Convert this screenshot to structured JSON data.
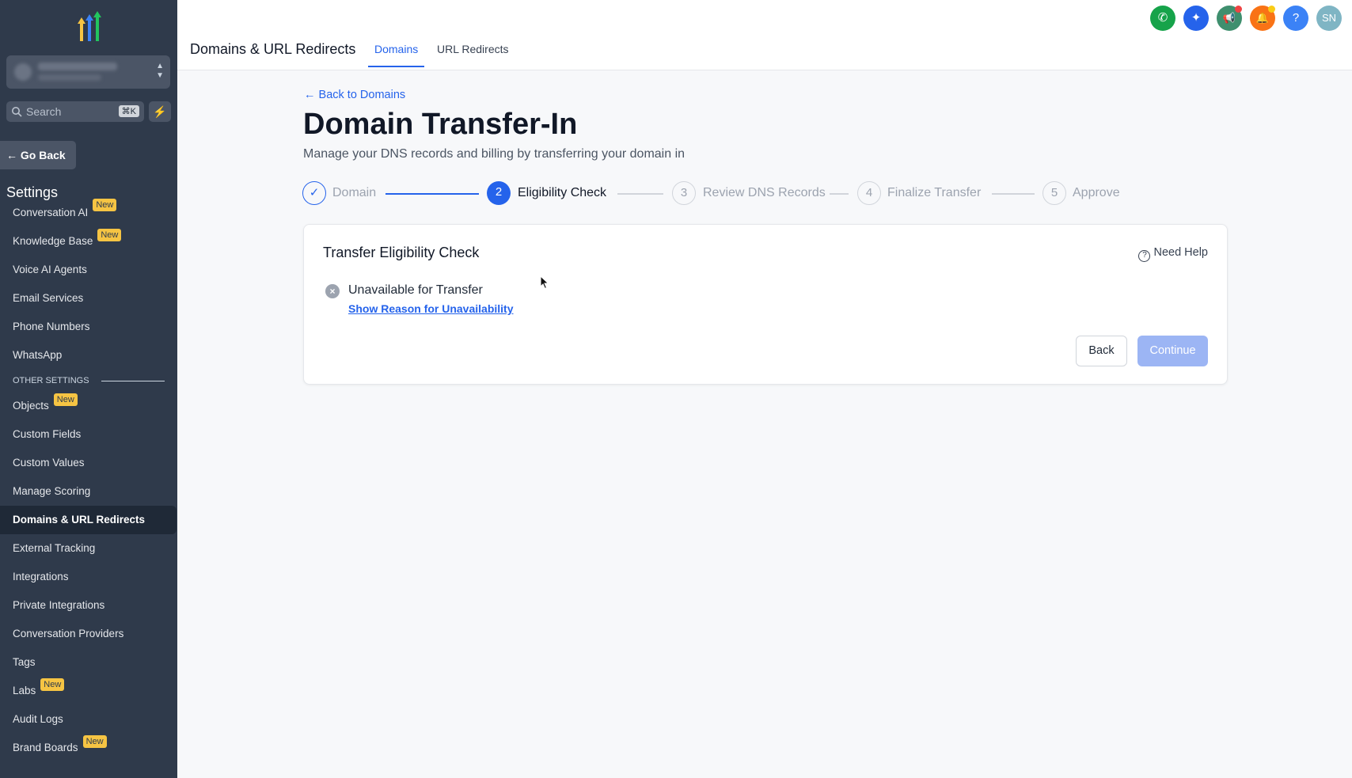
{
  "sidebar": {
    "search_placeholder": "Search",
    "search_shortcut": "⌘K",
    "go_back_label": "Go Back",
    "settings_title": "Settings",
    "items_top": [
      {
        "label": "Conversation AI",
        "badge": "New"
      },
      {
        "label": "Knowledge Base",
        "badge": "New"
      },
      {
        "label": "Voice AI Agents",
        "badge": ""
      },
      {
        "label": "Email Services",
        "badge": ""
      },
      {
        "label": "Phone Numbers",
        "badge": ""
      },
      {
        "label": "WhatsApp",
        "badge": ""
      }
    ],
    "section_label": "OTHER SETTINGS",
    "items_bottom": [
      {
        "label": "Objects",
        "badge": "New"
      },
      {
        "label": "Custom Fields",
        "badge": ""
      },
      {
        "label": "Custom Values",
        "badge": ""
      },
      {
        "label": "Manage Scoring",
        "badge": ""
      },
      {
        "label": "Domains & URL Redirects",
        "badge": "",
        "active": true
      },
      {
        "label": "External Tracking",
        "badge": ""
      },
      {
        "label": "Integrations",
        "badge": ""
      },
      {
        "label": "Private Integrations",
        "badge": ""
      },
      {
        "label": "Conversation Providers",
        "badge": ""
      },
      {
        "label": "Tags",
        "badge": ""
      },
      {
        "label": "Labs",
        "badge": "New"
      },
      {
        "label": "Audit Logs",
        "badge": ""
      },
      {
        "label": "Brand Boards",
        "badge": "New"
      }
    ]
  },
  "header": {
    "title": "Domains & URL Redirects",
    "tabs": [
      {
        "label": "Domains",
        "active": true
      },
      {
        "label": "URL Redirects",
        "active": false
      }
    ],
    "icons": [
      {
        "name": "phone-icon",
        "glyph": "✆",
        "color": "#16a34a"
      },
      {
        "name": "ai-sparkle-icon",
        "glyph": "✦",
        "color": "#2563eb"
      },
      {
        "name": "megaphone-icon",
        "glyph": "📢",
        "color": "#3f8f6e"
      },
      {
        "name": "bell-icon",
        "glyph": "🔔",
        "color": "#f97316"
      },
      {
        "name": "help-icon",
        "glyph": "?",
        "color": "#3b82f6"
      },
      {
        "name": "avatar",
        "glyph": "SN",
        "color": "#7fb5c4"
      }
    ]
  },
  "main": {
    "back_link": "Back to Domains",
    "title": "Domain Transfer-In",
    "subtitle": "Manage your DNS records and billing by transferring your domain in",
    "steps": [
      {
        "num": "✓",
        "label": "Domain",
        "state": "done"
      },
      {
        "num": "2",
        "label": "Eligibility Check",
        "state": "active"
      },
      {
        "num": "3",
        "label": "Review DNS Records",
        "state": "pending"
      },
      {
        "num": "4",
        "label": "Finalize Transfer",
        "state": "pending"
      },
      {
        "num": "5",
        "label": "Approve",
        "state": "pending"
      }
    ],
    "card": {
      "title": "Transfer Eligibility Check",
      "need_help": "Need Help",
      "status": "Unavailable for Transfer",
      "reason_link": "Show Reason for Unavailability",
      "back_button": "Back",
      "continue_button": "Continue"
    }
  },
  "colors": {
    "sidebar_bg": "#2f3a4b",
    "accent": "#2563eb",
    "badge": "#f6c443",
    "continue_disabled": "#9cb5f4"
  }
}
